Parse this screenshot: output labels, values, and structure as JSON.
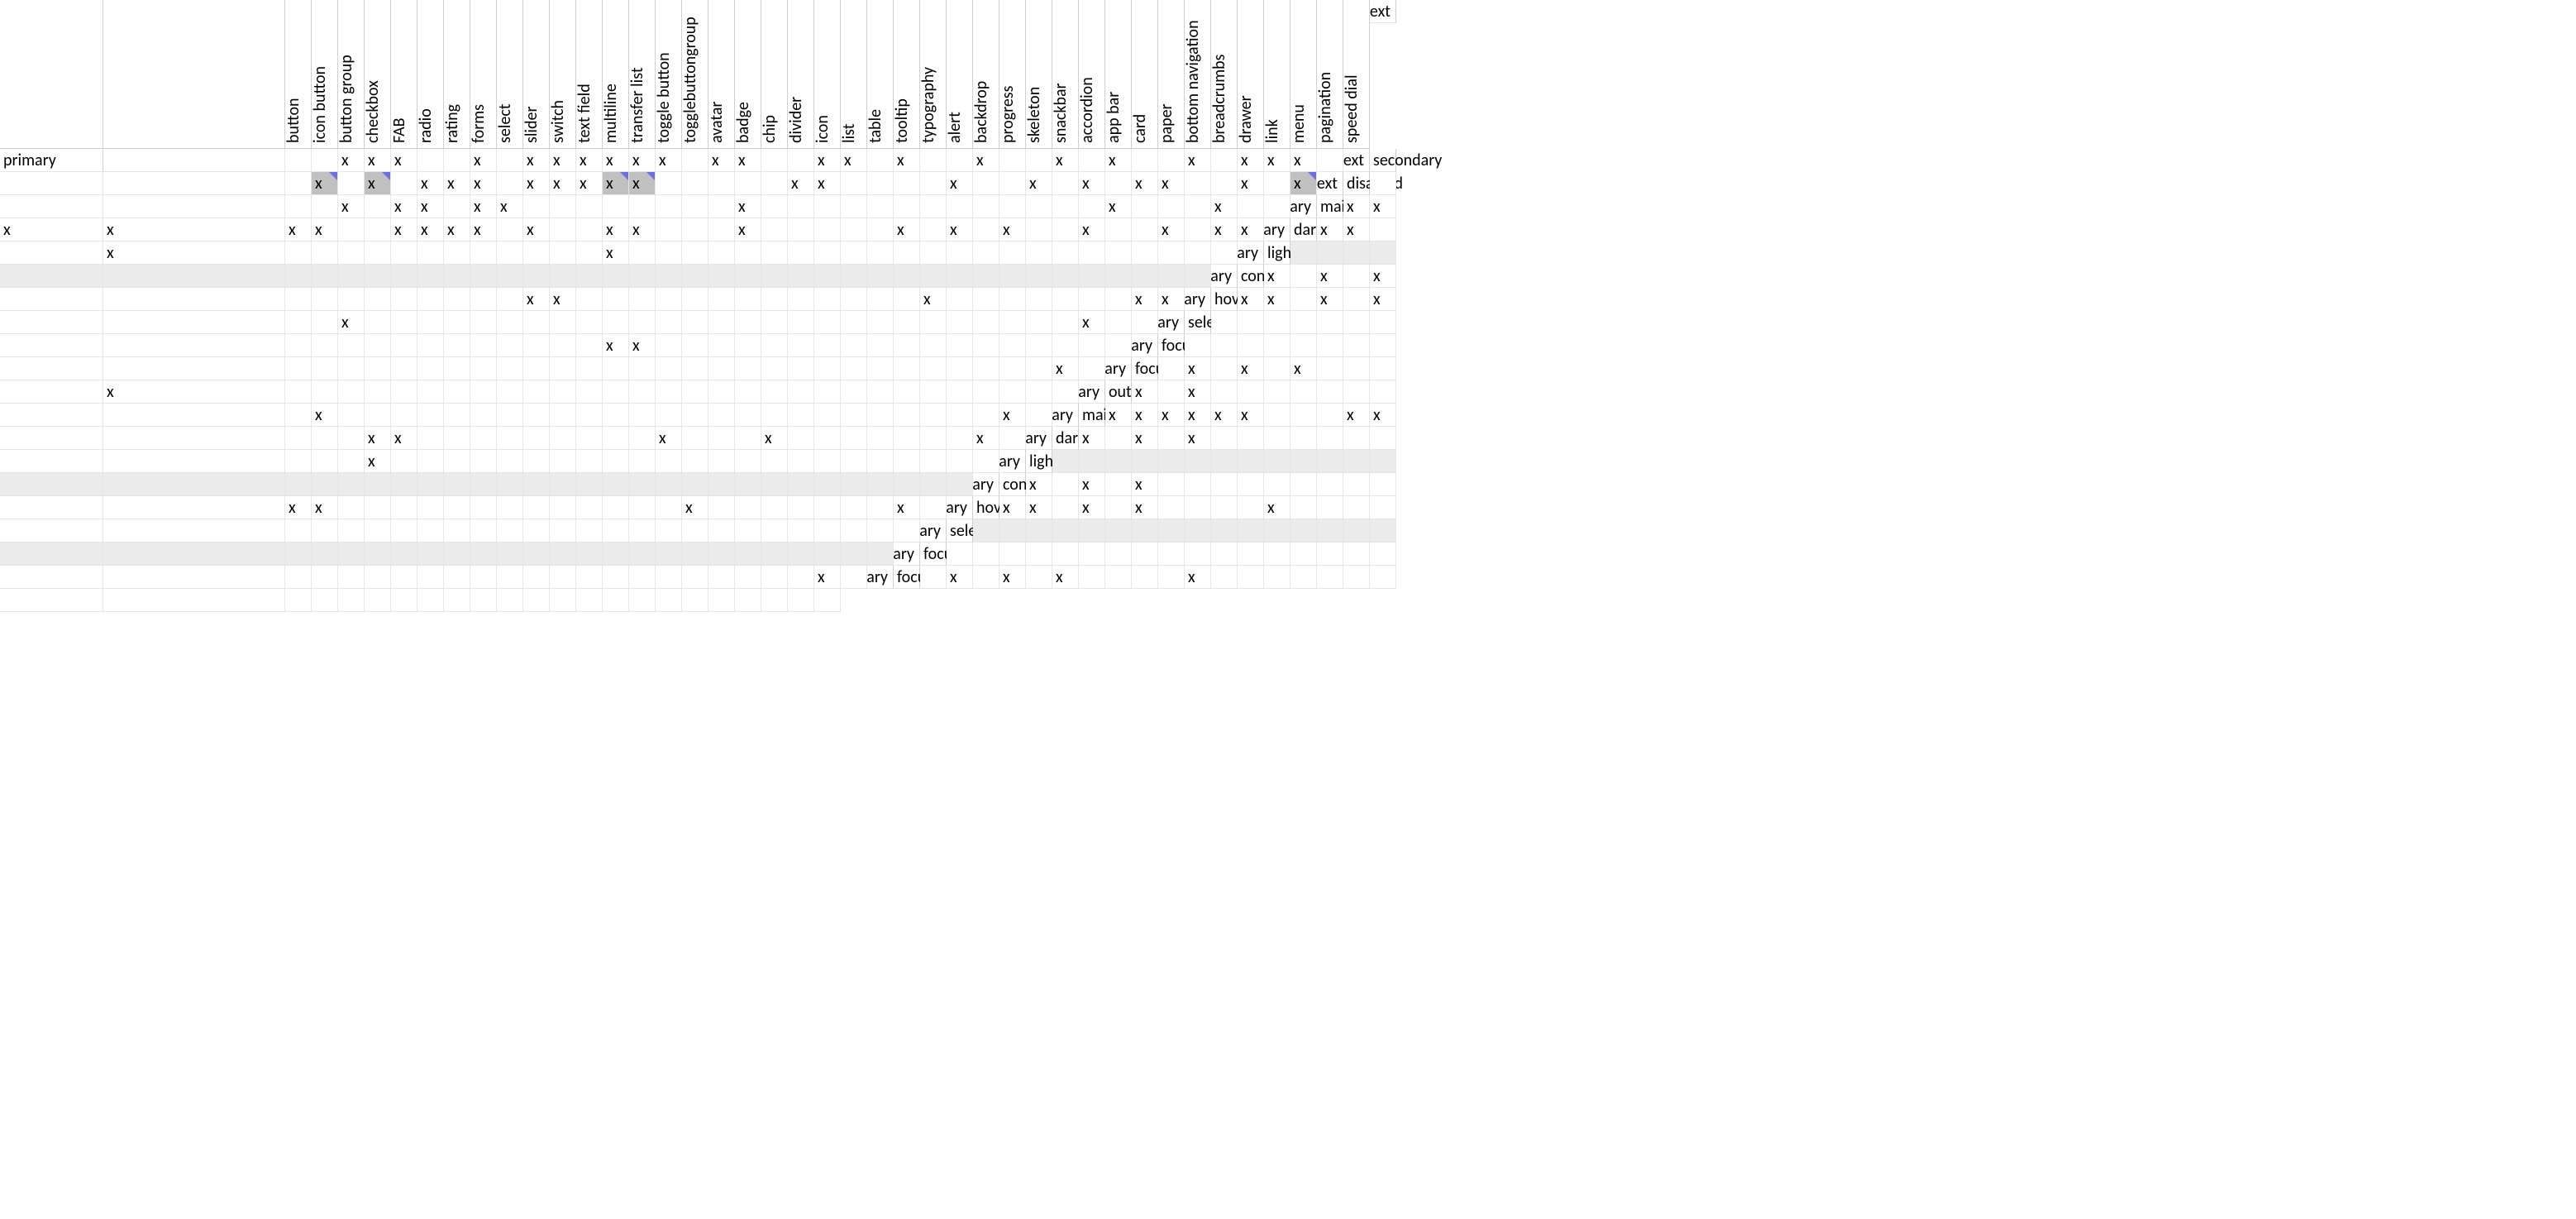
{
  "mark": "x",
  "columns": [
    "button",
    "icon button",
    "button group",
    "checkbox",
    "FAB",
    "radio",
    "rating",
    "forms",
    "select",
    "slider",
    "switch",
    "text field",
    "multiline",
    "transfer list",
    "toggle button",
    "togglebuttongroup",
    "avatar",
    "badge",
    "chip",
    "divider",
    "icon",
    "list",
    "table",
    "tooltip",
    "typography",
    "alert",
    "backdrop",
    "progress",
    "skeleton",
    "snackbar",
    "accordion",
    "app bar",
    "card",
    "paper",
    "bottom navigation",
    "breadcrumbs",
    "drawer",
    "link",
    "menu",
    "pagination",
    "speed dial"
  ],
  "rows": [
    {
      "group": "text",
      "token": "primary",
      "cells": [
        0,
        0,
        0,
        1,
        1,
        1,
        0,
        0,
        1,
        0,
        1,
        1,
        1,
        1,
        1,
        1,
        0,
        1,
        1,
        0,
        0,
        1,
        1,
        0,
        1,
        0,
        0,
        1,
        0,
        0,
        1,
        0,
        1,
        0,
        0,
        1,
        0,
        1,
        1,
        1,
        0
      ]
    },
    {
      "group": "text",
      "token": "secondary",
      "cells": [
        0,
        0,
        0,
        1,
        0,
        1,
        0,
        1,
        1,
        1,
        0,
        1,
        1,
        1,
        1,
        1,
        0,
        0,
        0,
        0,
        0,
        1,
        1,
        0,
        0,
        0,
        0,
        1,
        0,
        0,
        1,
        0,
        1,
        0,
        1,
        1,
        0,
        0,
        1,
        0,
        1
      ],
      "comments": [
        3,
        5,
        14,
        15,
        40
      ],
      "greycomments": [
        3,
        5,
        14,
        15,
        40
      ]
    },
    {
      "group": "text",
      "token": "disabled",
      "cells": [
        0,
        0,
        0,
        0,
        0,
        1,
        0,
        1,
        1,
        0,
        1,
        1,
        0,
        0,
        0,
        0,
        0,
        0,
        0,
        0,
        1,
        0,
        0,
        0,
        0,
        0,
        0,
        0,
        0,
        0,
        0,
        0,
        0,
        0,
        1,
        0,
        0,
        0,
        1,
        0,
        0
      ]
    },
    {
      "group": "primary",
      "token": "main",
      "cells": [
        1,
        1,
        1,
        1,
        1,
        1,
        0,
        0,
        1,
        1,
        1,
        1,
        0,
        1,
        0,
        0,
        1,
        1,
        0,
        0,
        0,
        1,
        0,
        0,
        0,
        0,
        0,
        1,
        0,
        1,
        0,
        1,
        0,
        0,
        1,
        0,
        0,
        1,
        0,
        1,
        1
      ]
    },
    {
      "group": "primary",
      "token": "dark",
      "cells": [
        1,
        1,
        0,
        0,
        1,
        0,
        0,
        0,
        0,
        0,
        0,
        0,
        0,
        0,
        0,
        0,
        0,
        1,
        0,
        0,
        0,
        0,
        0,
        0,
        0,
        0,
        0,
        0,
        0,
        0,
        0,
        0,
        0,
        0,
        0,
        0,
        0,
        0,
        0,
        0,
        0
      ]
    },
    {
      "group": "primary",
      "token": "light",
      "cells": [],
      "empty": true
    },
    {
      "group": "primary",
      "token": "contrast",
      "cells": [
        1,
        0,
        1,
        0,
        1,
        0,
        0,
        0,
        0,
        0,
        0,
        0,
        0,
        0,
        0,
        0,
        1,
        1,
        0,
        0,
        0,
        0,
        0,
        0,
        0,
        0,
        0,
        0,
        0,
        0,
        0,
        1,
        0,
        0,
        0,
        0,
        0,
        0,
        0,
        1,
        1
      ]
    },
    {
      "group": "primary",
      "token": "hover",
      "cells": [
        1,
        1,
        0,
        1,
        0,
        1,
        0,
        0,
        0,
        0,
        1,
        0,
        0,
        0,
        0,
        0,
        0,
        0,
        0,
        0,
        0,
        0,
        0,
        0,
        0,
        0,
        0,
        0,
        0,
        0,
        0,
        0,
        0,
        0,
        0,
        0,
        0,
        0,
        1,
        0,
        0
      ]
    },
    {
      "group": "primary",
      "token": "selected",
      "cells": [
        0,
        0,
        0,
        0,
        0,
        0,
        0,
        0,
        0,
        0,
        0,
        0,
        0,
        0,
        0,
        0,
        0,
        0,
        0,
        0,
        0,
        1,
        1,
        0,
        0,
        0,
        0,
        0,
        0,
        0,
        0,
        0,
        0,
        0,
        0,
        0,
        0,
        0,
        0,
        0,
        0
      ]
    },
    {
      "group": "primary",
      "token": "focus",
      "cells": [
        0,
        0,
        0,
        0,
        0,
        0,
        0,
        0,
        0,
        0,
        0,
        0,
        0,
        0,
        0,
        0,
        0,
        0,
        0,
        0,
        0,
        0,
        0,
        0,
        0,
        0,
        0,
        0,
        0,
        0,
        0,
        0,
        0,
        0,
        0,
        0,
        0,
        0,
        0,
        1,
        0
      ]
    },
    {
      "group": "primary",
      "token": "focusVisible",
      "cells": [
        0,
        1,
        0,
        1,
        0,
        1,
        0,
        0,
        0,
        0,
        1,
        0,
        0,
        0,
        0,
        0,
        0,
        0,
        0,
        0,
        0,
        0,
        0,
        0,
        0,
        0,
        0,
        0,
        0,
        0,
        0,
        0,
        0,
        0,
        0,
        0,
        0,
        0,
        0,
        0,
        0
      ]
    },
    {
      "group": "primary",
      "token": "outlinedBorder",
      "cells": [
        1,
        0,
        1,
        0,
        0,
        0,
        0,
        0,
        0,
        0,
        0,
        0,
        0,
        1,
        0,
        0,
        0,
        0,
        0,
        0,
        0,
        0,
        0,
        0,
        0,
        0,
        0,
        0,
        0,
        0,
        0,
        0,
        0,
        0,
        0,
        0,
        0,
        0,
        0,
        1,
        0
      ]
    },
    {
      "group": "secondary",
      "token": "main",
      "cells": [
        1,
        1,
        1,
        1,
        1,
        1,
        0,
        0,
        0,
        1,
        1,
        0,
        0,
        0,
        0,
        0,
        1,
        1,
        0,
        0,
        0,
        0,
        0,
        0,
        0,
        0,
        0,
        1,
        0,
        0,
        0,
        1,
        0,
        0,
        0,
        0,
        0,
        0,
        0,
        1,
        0
      ]
    },
    {
      "group": "secondary",
      "token": "dark",
      "cells": [
        1,
        0,
        1,
        0,
        1,
        0,
        0,
        0,
        0,
        0,
        0,
        0,
        0,
        0,
        0,
        0,
        0,
        1,
        0,
        0,
        0,
        0,
        0,
        0,
        0,
        0,
        0,
        0,
        0,
        0,
        0,
        0,
        0,
        0,
        0,
        0,
        0,
        0,
        0,
        0,
        0
      ]
    },
    {
      "group": "secondary",
      "token": "light",
      "cells": [],
      "empty": true
    },
    {
      "group": "secondary",
      "token": "contrast",
      "cells": [
        1,
        0,
        1,
        0,
        1,
        0,
        0,
        0,
        0,
        0,
        0,
        0,
        0,
        0,
        0,
        0,
        1,
        1,
        0,
        0,
        0,
        0,
        0,
        0,
        0,
        0,
        0,
        0,
        0,
        0,
        0,
        1,
        0,
        0,
        0,
        0,
        0,
        0,
        0,
        1,
        0
      ]
    },
    {
      "group": "secondary",
      "token": "hover",
      "cells": [
        1,
        1,
        0,
        1,
        0,
        1,
        0,
        0,
        0,
        0,
        1,
        0,
        0,
        0,
        0,
        0,
        0,
        0,
        0,
        0,
        0,
        0,
        0,
        0,
        0,
        0,
        0,
        0,
        0,
        0,
        0,
        0,
        0,
        0,
        0,
        0,
        0,
        0,
        0,
        0,
        0
      ]
    },
    {
      "group": "secondary",
      "token": "selected",
      "cells": [],
      "empty": true
    },
    {
      "group": "secondary",
      "token": "focus",
      "cells": [
        0,
        0,
        0,
        0,
        0,
        0,
        0,
        0,
        0,
        0,
        0,
        0,
        0,
        0,
        0,
        0,
        0,
        0,
        0,
        0,
        0,
        0,
        0,
        0,
        0,
        0,
        0,
        0,
        0,
        0,
        0,
        0,
        0,
        0,
        0,
        0,
        0,
        0,
        0,
        1,
        0
      ]
    },
    {
      "group": "secondary",
      "token": "focusVisible",
      "cells": [
        0,
        1,
        0,
        1,
        0,
        1,
        0,
        0,
        0,
        0,
        1,
        0,
        0,
        0,
        0,
        0,
        0,
        0,
        0,
        0,
        0,
        0,
        0,
        0,
        0,
        0,
        0,
        0,
        0,
        0,
        0,
        0,
        0,
        0,
        0,
        0,
        0,
        0,
        0,
        0,
        0
      ]
    }
  ]
}
